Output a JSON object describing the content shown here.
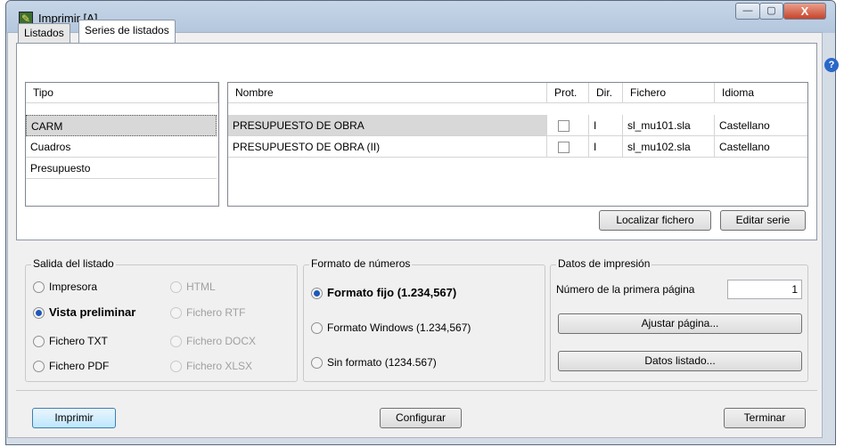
{
  "window": {
    "title": "Imprimir [A]",
    "icon": "app-tool-icon",
    "controls": {
      "minimize": "—",
      "maximize": "▢",
      "close": "X"
    }
  },
  "tabs": [
    {
      "label": "Listados",
      "active": false
    },
    {
      "label": "Series de listados",
      "active": true
    }
  ],
  "tipo_list": {
    "header": "Tipo",
    "items": [
      "CARM",
      "Cuadros",
      "Presupuesto"
    ],
    "selected_index": 0
  },
  "series_table": {
    "headers": {
      "nombre": "Nombre",
      "prot": "Prot.",
      "dir": "Dir.",
      "fichero": "Fichero",
      "idioma": "Idioma"
    },
    "rows": [
      {
        "nombre": "PRESUPUESTO DE OBRA",
        "prot": false,
        "dir": "I",
        "fichero": "sl_mu101.sla",
        "idioma": "Castellano"
      },
      {
        "nombre": "PRESUPUESTO DE OBRA (II)",
        "prot": false,
        "dir": "I",
        "fichero": "sl_mu102.sla",
        "idioma": "Castellano"
      }
    ],
    "selected_index": 0
  },
  "panel_buttons": {
    "localizar": "Localizar fichero",
    "editar": "Editar serie"
  },
  "salida": {
    "title": "Salida del listado",
    "options": [
      {
        "label": "Impresora",
        "checked": false,
        "enabled": true
      },
      {
        "label": "Vista preliminar",
        "checked": true,
        "enabled": true
      },
      {
        "label": "Fichero TXT",
        "checked": false,
        "enabled": true
      },
      {
        "label": "Fichero PDF",
        "checked": false,
        "enabled": true
      },
      {
        "label": "HTML",
        "checked": false,
        "enabled": false
      },
      {
        "label": "Fichero RTF",
        "checked": false,
        "enabled": false
      },
      {
        "label": "Fichero DOCX",
        "checked": false,
        "enabled": false
      },
      {
        "label": "Fichero XLSX",
        "checked": false,
        "enabled": false
      }
    ]
  },
  "formato": {
    "title": "Formato de números",
    "options": [
      {
        "label": "Formato fijo (1.234,567)",
        "checked": true
      },
      {
        "label": "Formato Windows (1.234,567)",
        "checked": false
      },
      {
        "label": "Sin formato (1234.567)",
        "checked": false
      }
    ]
  },
  "datos": {
    "title": "Datos de impresión",
    "first_page_label": "Número de la primera página",
    "first_page_value": "1",
    "ajustar": "Ajustar página...",
    "datos_listado": "Datos listado..."
  },
  "footer": {
    "imprimir": "Imprimir",
    "configurar": "Configurar",
    "terminar": "Terminar"
  }
}
